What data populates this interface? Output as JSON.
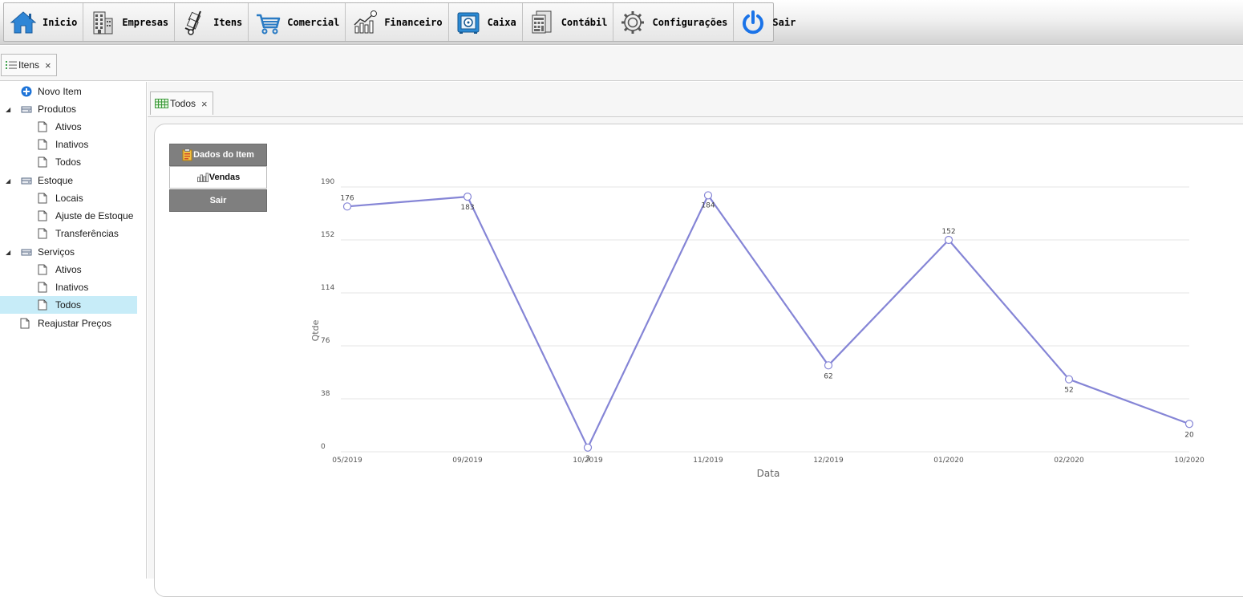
{
  "toolbar": {
    "items": [
      {
        "label": "Inicio",
        "icon": "home-icon"
      },
      {
        "label": "Empresas",
        "icon": "building-icon"
      },
      {
        "label": "Itens",
        "icon": "hand-truck-icon"
      },
      {
        "label": "Comercial",
        "icon": "shopping-cart-icon"
      },
      {
        "label": "Financeiro",
        "icon": "finance-chart-icon"
      },
      {
        "label": "Caixa",
        "icon": "safe-icon"
      },
      {
        "label": "Contábil",
        "icon": "ledger-icon"
      },
      {
        "label": "Configurações",
        "icon": "gear-icon"
      },
      {
        "label": "Sair",
        "icon": "power-icon"
      }
    ]
  },
  "outer_tab": {
    "label": "Itens",
    "close": "×",
    "icon": "list-icon"
  },
  "inner_tab": {
    "label": "Todos",
    "close": "×",
    "icon": "grid-icon"
  },
  "tree": [
    {
      "label": "Novo Item",
      "icon": "add-circle-icon"
    },
    {
      "label": "Produtos",
      "icon": "drive-icon"
    },
    {
      "label": "Ativos",
      "icon": "page-icon"
    },
    {
      "label": "Inativos",
      "icon": "page-icon"
    },
    {
      "label": "Todos",
      "icon": "page-icon"
    },
    {
      "label": "Estoque",
      "icon": "drive-icon"
    },
    {
      "label": "Locais",
      "icon": "page-icon"
    },
    {
      "label": "Ajuste de Estoque",
      "icon": "page-icon"
    },
    {
      "label": "Transferências",
      "icon": "page-icon"
    },
    {
      "label": "Serviços",
      "icon": "drive-icon"
    },
    {
      "label": "Ativos",
      "icon": "page-icon"
    },
    {
      "label": "Inativos",
      "icon": "page-icon"
    },
    {
      "label": "Todos",
      "icon": "page-icon",
      "selected": true
    },
    {
      "label": "Reajustar Preços",
      "icon": "page-icon"
    }
  ],
  "side_menu": {
    "dados": "Dados do Item",
    "vendas": "Vendas",
    "sair": "Sair"
  },
  "colors": {
    "line": "#8585d6",
    "selected_row": "#c7ecf8",
    "side_button": "#7f7f7f",
    "accent_blue": "#1a73e8"
  },
  "chart_data": {
    "type": "line",
    "categories": [
      "05/2019",
      "09/2019",
      "10/2019",
      "11/2019",
      "12/2019",
      "01/2020",
      "02/2020",
      "10/2020"
    ],
    "values": [
      176,
      183,
      3,
      184,
      62,
      152,
      52,
      20
    ],
    "xlabel": "Data",
    "ylabel": "Qtde",
    "yticks": [
      "0",
      "38",
      "76",
      "114",
      "152",
      "190"
    ],
    "ylim": [
      0,
      190
    ],
    "grid": true
  }
}
